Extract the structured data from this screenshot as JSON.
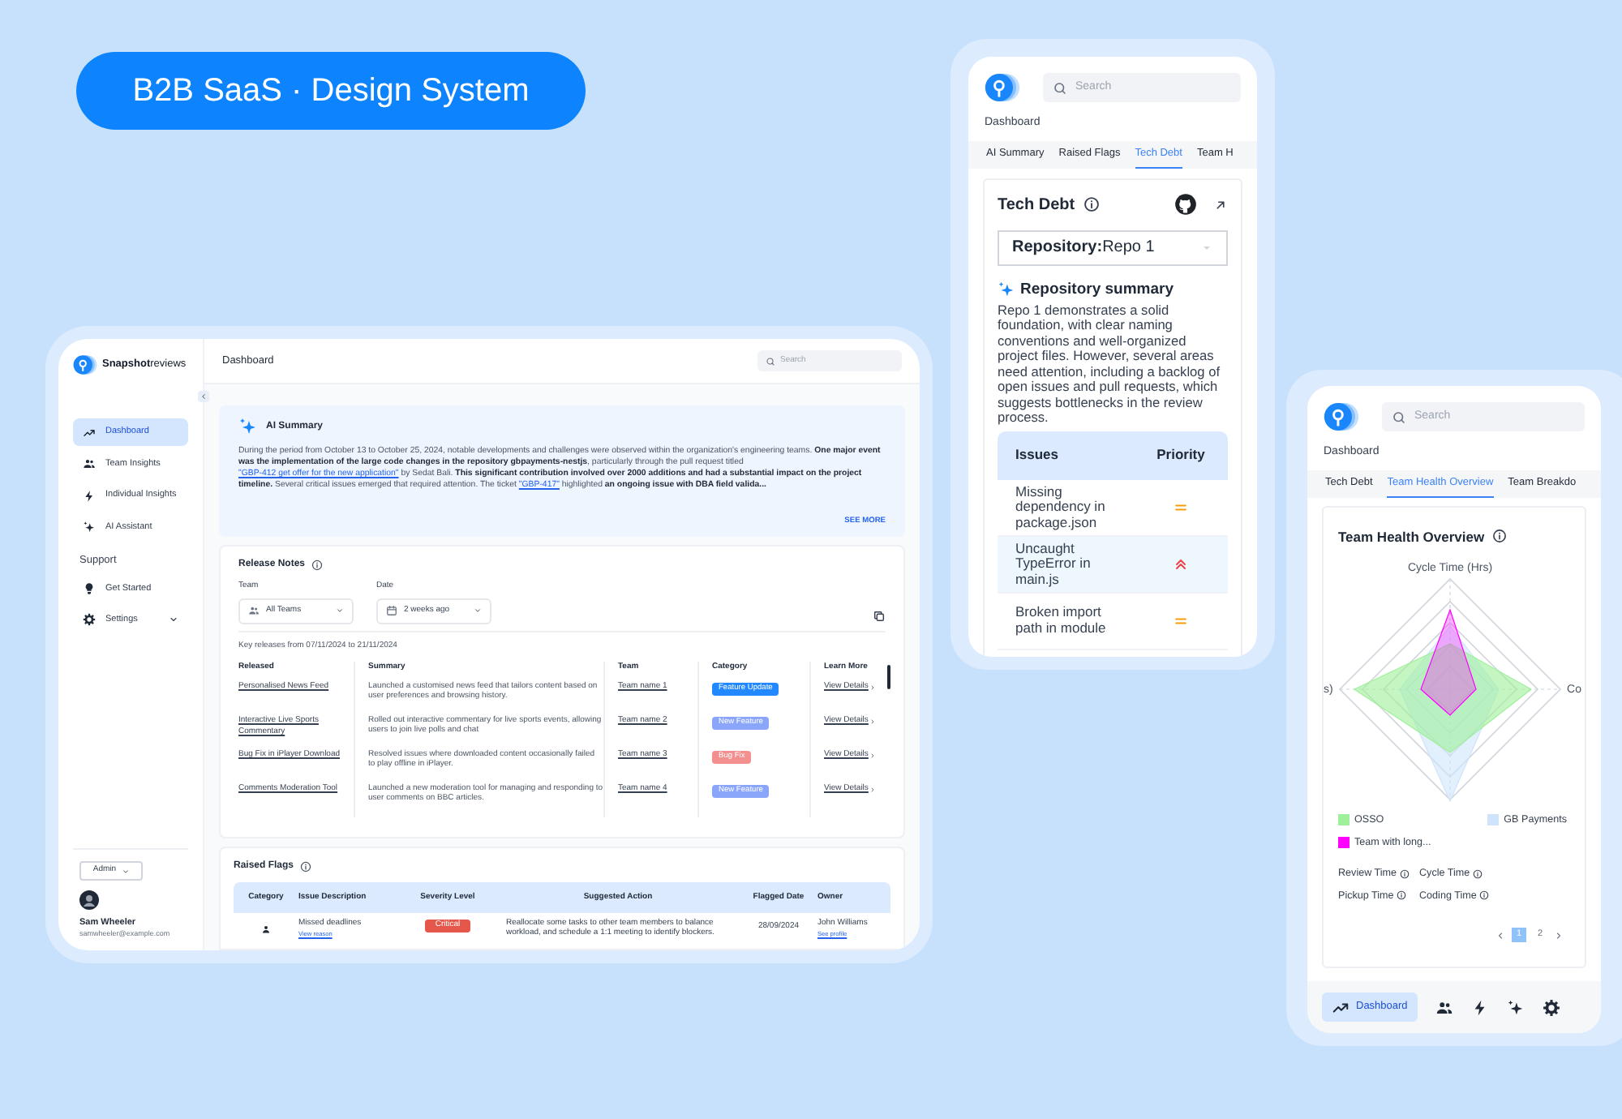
{
  "badge": "B2B SaaS · Design System",
  "desktop": {
    "logo": "**Snapshot**reviews",
    "page_title": "Dashboard",
    "search": {
      "placeholder": "Search"
    },
    "nav": [
      {
        "kind": "trend",
        "label": "Dashboard",
        "selected": true
      },
      {
        "kind": "people",
        "label": "Team Insights",
        "selected": false
      },
      {
        "kind": "bolt",
        "label": "Individual Insights",
        "selected": false
      },
      {
        "kind": "sparkle",
        "label": "AI Assistant",
        "selected": false
      }
    ],
    "support_heading": "Support",
    "support_nav": [
      {
        "kind": "bulb",
        "label": "Get Started",
        "submenu": false
      },
      {
        "kind": "gear",
        "label": "Settings",
        "submenu": true
      }
    ],
    "role": "Admin",
    "user": {
      "name": "Sam Wheeler",
      "email": "samwheeler@example.com"
    },
    "ai_summary": {
      "title": "AI Summary",
      "segments": [
        {
          "kind": "plain",
          "text": "During the period from October 13 to October 25, 2024, notable developments and challenges were observed within the organization's engineering teams. "
        },
        {
          "kind": "bold",
          "text": "One major event was the implementation of the large code changes in the repository gbpayments-nestjs"
        },
        {
          "kind": "plain",
          "text": ", particularly through the pull request titled "
        },
        {
          "kind": "link",
          "text": "\"GBP-412 get offer for the new application\""
        },
        {
          "kind": "plain",
          "text": " by Sedat Bali. "
        },
        {
          "kind": "bold",
          "text": "This significant contribution involved over 2000 additions and had a substantial impact on the project timeline."
        },
        {
          "kind": "plain",
          "text": " Several critical issues emerged that required attention. The ticket "
        },
        {
          "kind": "link",
          "text": "\"GBP-417\""
        },
        {
          "kind": "plain",
          "text": " highlighted "
        },
        {
          "kind": "bold",
          "text": "an ongoing issue with DBA field valida..."
        }
      ],
      "more": "SEE MORE"
    },
    "release_notes": {
      "title": "Release Notes",
      "filters": [
        {
          "kind": "people",
          "label": "Team",
          "value": "All Teams"
        },
        {
          "kind": "calendar",
          "label": "Date",
          "value": "2 weeks ago"
        }
      ],
      "range": "Key releases from 07/11/2024 to 21/11/2024",
      "columns": [
        "Released",
        "Summary",
        "Team",
        "Category",
        "Learn More"
      ],
      "rows": [
        {
          "released": "Personalised News Feed",
          "summary": "Launched a customised news feed that tailors content based on user preferences and browsing history.",
          "team": "Team name 1",
          "category": "Feature Update",
          "color": "#2188ff",
          "link": "View Details"
        },
        {
          "released": "Interactive Live Sports Commentary",
          "summary": "Rolled out interactive commentary for live sports events, allowing users to join live polls and chat",
          "team": "Team name 2",
          "category": "New Feature",
          "color": "#8aa6fb",
          "link": "View Details"
        },
        {
          "released": "Bug Fix in iPlayer Download",
          "summary": "Resolved issues where downloaded content occasionally failed to play offline in iPlayer.",
          "team": "Team name 3",
          "category": "Bug Fix",
          "color": "#f38f8f",
          "link": "View Details"
        },
        {
          "released": "Comments Moderation Tool",
          "summary": "Launched a new moderation tool for managing and responding to user comments on BBC articles.",
          "team": "Team name 4",
          "category": "New Feature",
          "color": "#8aa6fb",
          "link": "View Details"
        }
      ]
    },
    "raised_flags": {
      "title": "Raised Flags",
      "columns": [
        "Category",
        "Issue Description",
        "Severity Level",
        "Suggested Action",
        "Flagged Date",
        "Owner"
      ],
      "rows": [
        {
          "issue": "Missed deadlines",
          "issue_link": "View reason",
          "severity": "Critical",
          "action": "Reallocate some tasks to other team members to balance workload, and schedule a 1:1 meeting to identify blockers.",
          "date": "28/09/2024",
          "owner": "John Williams",
          "owner_link": "See profile"
        }
      ]
    }
  },
  "tech_phone": {
    "search": {
      "placeholder": "Search"
    },
    "page_title": "Dashboard",
    "tabs": [
      {
        "label": "AI Summary",
        "selected": false
      },
      {
        "label": "Raised Flags",
        "selected": false
      },
      {
        "label": "Tech Debt",
        "selected": true
      },
      {
        "label": "Team H",
        "selected": false
      }
    ],
    "card_title": "Tech Debt",
    "repository": "**Repository:**Repo 1",
    "summary_title": "Repository summary",
    "summary": "Repo 1 demonstrates a solid foundation, with clear naming conventions and well-organized project files. However, several areas need attention, including a backlog of open issues and pull requests, which suggests bottlenecks in the review process.",
    "columns": [
      "Issues",
      "Priority"
    ],
    "rows": [
      {
        "issue": "Missing dependency in package.json",
        "kind": "medium",
        "selected": false
      },
      {
        "issue": "Uncaught TypeError in main.js",
        "kind": "high",
        "selected": true
      },
      {
        "issue": "Broken import path in module",
        "kind": "medium",
        "selected": false
      }
    ]
  },
  "health_phone": {
    "search": {
      "placeholder": "Search"
    },
    "page_title": "Dashboard",
    "tabs": [
      {
        "label": "Tech Debt",
        "selected": false
      },
      {
        "label": "Team Health Overview",
        "selected": true
      },
      {
        "label": "Team Breakdo",
        "selected": false
      }
    ],
    "card_title": "Team Health Overview",
    "axis_labels": [
      "Cycle Time (Hrs)",
      "s)",
      "Co"
    ],
    "legend": [
      {
        "label": "OSSO",
        "color": "#9ff09a"
      },
      {
        "label": "GB Payments",
        "color": "#cfe4fb"
      },
      {
        "label": "Team with long...",
        "color": "#ff00ff"
      }
    ],
    "metrics": [
      "Review Time",
      "Cycle Time",
      "Pickup Time",
      "Coding Time"
    ],
    "pages": [
      {
        "label": "1",
        "selected": true
      },
      {
        "label": "2",
        "selected": false
      }
    ],
    "bottom_nav": [
      {
        "kind": "trend",
        "label": "Dashboard",
        "selected": true
      },
      {
        "kind": "people",
        "selected": false
      },
      {
        "kind": "bolt",
        "selected": false
      },
      {
        "kind": "sparkle",
        "selected": false
      },
      {
        "kind": "gear",
        "selected": false
      }
    ]
  }
}
